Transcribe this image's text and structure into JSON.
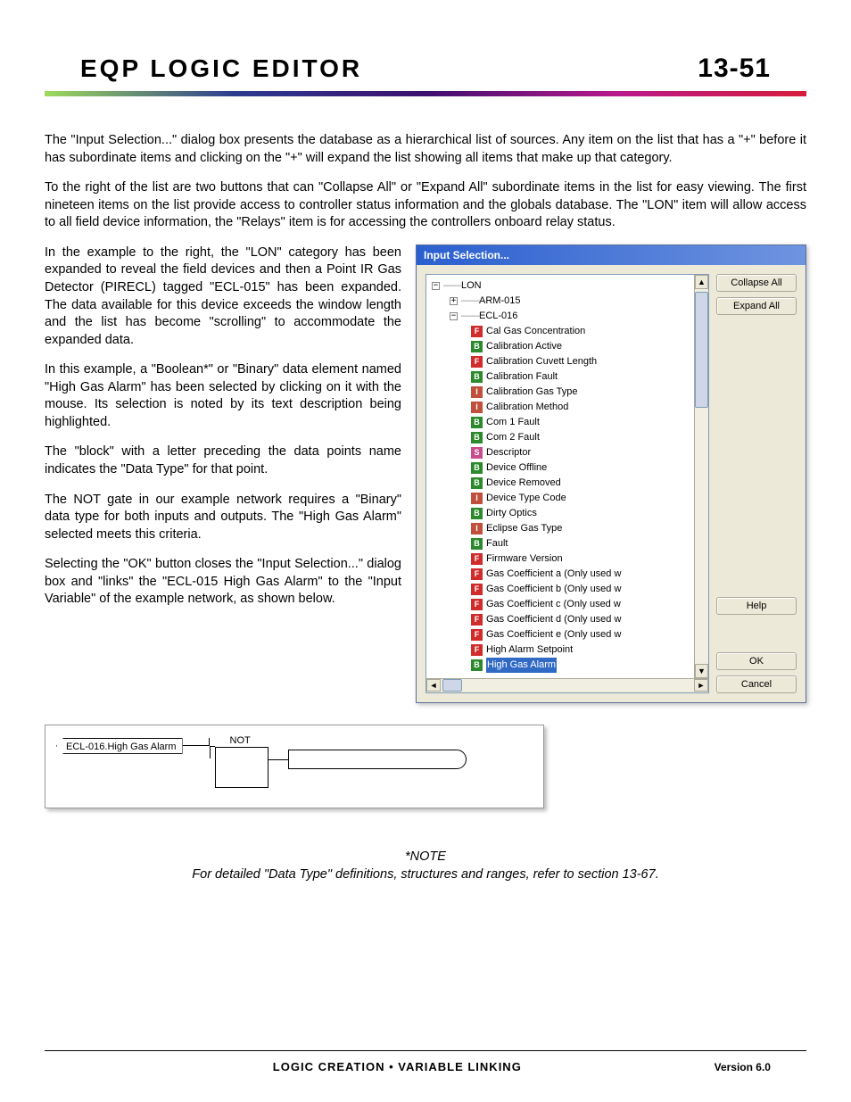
{
  "header": {
    "title": "Eqp Logic Editor",
    "page_number": "13-51"
  },
  "body": {
    "p1": "The \"Input Selection...\" dialog box presents the database as a hierarchical list of sources.  Any item on the list that has a \"+\" before it has subordinate items and clicking on the \"+\" will expand the list showing all items that make up that category.",
    "p2": "To the right of the list are two buttons that can \"Collapse All\" or \"Expand All\" subordinate items in the list for easy viewing.  The first nineteen items on the list provide access to controller status information and the globals database.  The \"LON\" item will allow access to all field device information, the \"Relays\" item is for accessing the controllers onboard relay status.",
    "p3": "In the example to the right, the \"LON\" category has been expanded to reveal the field devices and then a Point IR Gas Detector (PIRECL) tagged \"ECL-015\" has been expanded.  The data available for this device exceeds the window length and the list has become \"scrolling\" to accommodate the expanded data.",
    "p4": "In this example, a \"Boolean*\" or \"Binary\" data element named \"High Gas Alarm\" has been selected by clicking on it with the mouse.  Its selection is noted by its text description being highlighted.",
    "p5": "The \"block\" with a letter preceding the data points name indicates the \"Data Type\" for that point.",
    "p6": "The NOT gate in our example network requires a \"Binary\" data type for both inputs and outputs.  The \"High Gas Alarm\" selected meets this criteria.",
    "p7": "Selecting the \"OK\" button closes the \"Input Selection...\" dialog box and \"links\" the \"ECL-015 High Gas Alarm\" to the \"Input Variable\" of the example network, as shown below."
  },
  "dialog": {
    "title": "Input Selection...",
    "root": "LON",
    "child1": "ARM-015",
    "child2": "ECL-016",
    "items": [
      {
        "t": "F",
        "label": "Cal Gas Concentration"
      },
      {
        "t": "B",
        "label": "Calibration Active"
      },
      {
        "t": "F",
        "label": "Calibration Cuvett Length"
      },
      {
        "t": "B",
        "label": "Calibration Fault"
      },
      {
        "t": "I",
        "label": "Calibration Gas Type"
      },
      {
        "t": "I",
        "label": "Calibration Method"
      },
      {
        "t": "B",
        "label": "Com 1 Fault"
      },
      {
        "t": "B",
        "label": "Com 2 Fault"
      },
      {
        "t": "S",
        "label": "Descriptor"
      },
      {
        "t": "B",
        "label": "Device Offline"
      },
      {
        "t": "B",
        "label": "Device Removed"
      },
      {
        "t": "I",
        "label": "Device Type Code"
      },
      {
        "t": "B",
        "label": "Dirty Optics"
      },
      {
        "t": "I",
        "label": "Eclipse Gas Type"
      },
      {
        "t": "B",
        "label": "Fault"
      },
      {
        "t": "F",
        "label": "Firmware Version"
      },
      {
        "t": "F",
        "label": "Gas Coefficient a (Only used w"
      },
      {
        "t": "F",
        "label": "Gas Coefficient b (Only used w"
      },
      {
        "t": "F",
        "label": "Gas Coefficient c (Only used w"
      },
      {
        "t": "F",
        "label": "Gas Coefficient d (Only used w"
      },
      {
        "t": "F",
        "label": "Gas Coefficient e (Only used w"
      },
      {
        "t": "F",
        "label": "High Alarm Setpoint"
      },
      {
        "t": "B",
        "label": "High Gas Alarm",
        "selected": true
      }
    ],
    "buttons": {
      "collapse": "Collapse All",
      "expand": "Expand All",
      "help": "Help",
      "ok": "OK",
      "cancel": "Cancel"
    }
  },
  "network": {
    "input_label": "ECL-016.High Gas Alarm",
    "gate_label": "NOT"
  },
  "note": {
    "line1": "*NOTE",
    "line2": "For detailed \"Data Type\" definitions, structures and ranges, refer to section 13-67."
  },
  "footer": {
    "center": "LOGIC CREATION • VARIABLE LINKING",
    "right": "Version 6.0"
  }
}
